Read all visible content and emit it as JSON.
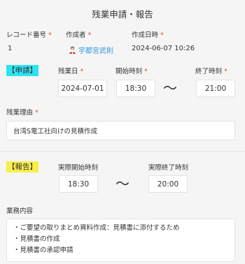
{
  "page": {
    "title": "残業申請・報告"
  },
  "header": {
    "record_no_label": "レコード番号",
    "record_no": "1",
    "creator_label": "作成者",
    "creator": "宇都宮武則",
    "created_at_label": "作成日時",
    "created_at": "2024-06-07 10:26",
    "required_mark": "*"
  },
  "application": {
    "tag": "【申請】",
    "date_label": "残業日",
    "date": "2024-07-01",
    "start_label": "開始時刻",
    "start": "18:30",
    "tilde": "〜",
    "end_label": "終了時刻",
    "end": "21:00",
    "reason_label": "残業理由",
    "reason": "台湾S電工社向けの見積作成"
  },
  "report": {
    "tag": "【報告】",
    "actual_start_label": "実際開始時刻",
    "actual_start": "18:30",
    "tilde": "〜",
    "actual_end_label": "実際終了時刻",
    "actual_end": "20:00",
    "work_label": "業務内容",
    "work_lines": [
      "・ご要望の取りまとめ資料作成：見積書に添付するため",
      "・見積書の作成",
      "・見積書の承認申請"
    ]
  },
  "colors": {
    "required": "#e74c3c",
    "link": "#3498db",
    "application_tag": "#2de3f2",
    "report_tag": "#f8f04a"
  }
}
